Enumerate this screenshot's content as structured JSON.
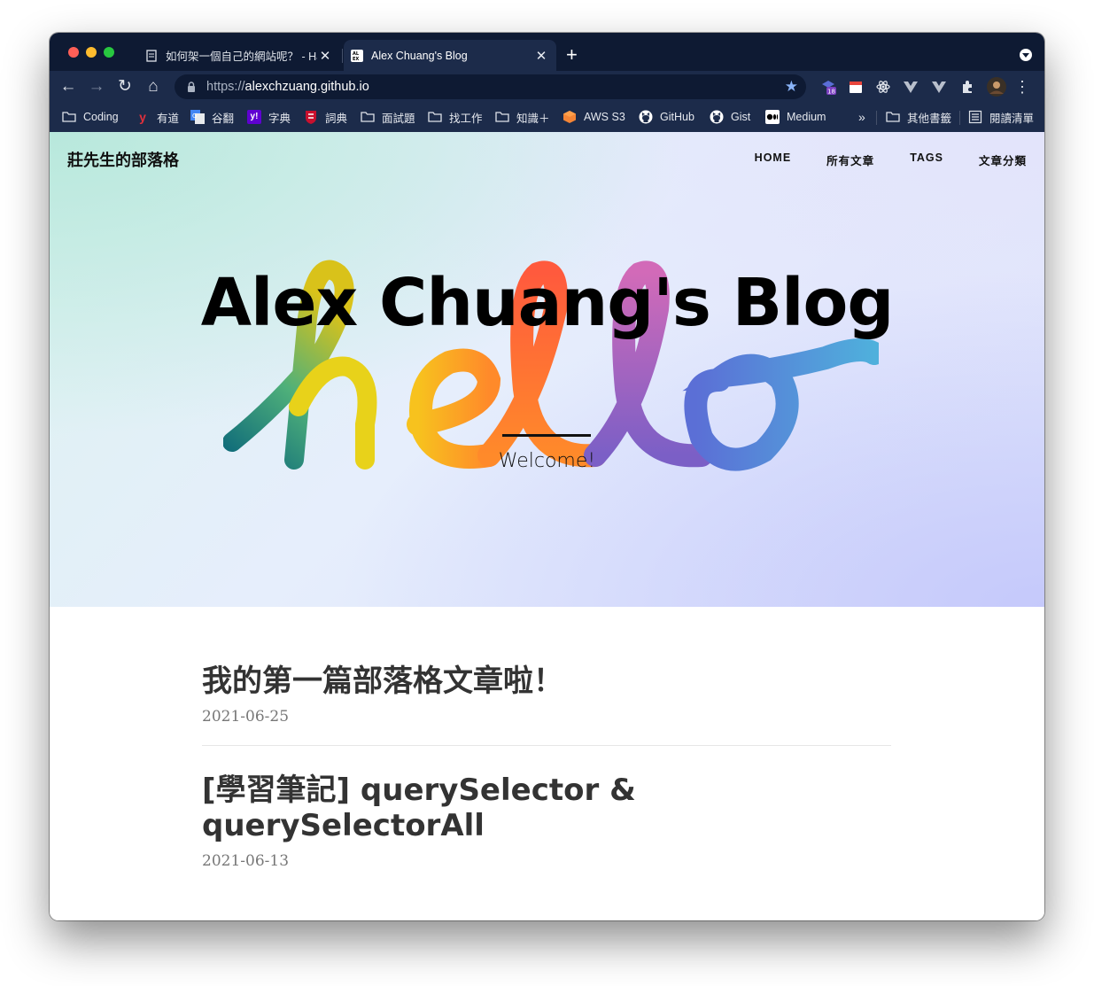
{
  "browser": {
    "tabs": [
      {
        "title": "如何架一個自己的網站呢？ - Ha",
        "active": false,
        "favicon": "document-icon"
      },
      {
        "title": "Alex Chuang's Blog",
        "active": true,
        "favicon": "site-favicon"
      }
    ],
    "url_scheme": "https://",
    "url_host": "alexchzuang.github.io",
    "extension_badge": "18",
    "bookmarks": [
      {
        "label": "Coding",
        "icon": "folder-icon"
      },
      {
        "label": "有道",
        "icon": "youdao-icon"
      },
      {
        "label": "谷翻",
        "icon": "google-translate-icon"
      },
      {
        "label": "字典",
        "icon": "yahoo-icon"
      },
      {
        "label": "詞典",
        "icon": "cambridge-icon"
      },
      {
        "label": "面試題",
        "icon": "folder-icon"
      },
      {
        "label": "找工作",
        "icon": "folder-icon"
      },
      {
        "label": "知識＋",
        "icon": "folder-icon"
      },
      {
        "label": "AWS S3",
        "icon": "aws-icon"
      },
      {
        "label": "GitHub",
        "icon": "github-icon"
      },
      {
        "label": "Gist",
        "icon": "github-icon"
      },
      {
        "label": "Medium",
        "icon": "medium-icon"
      }
    ],
    "overflow": "»",
    "other_bookmarks": "其他書籤",
    "reading_list": "閱讀清單"
  },
  "site": {
    "name": "莊先生的部落格",
    "nav": [
      "HOME",
      "所有文章",
      "TAGS",
      "文章分類"
    ],
    "hero_title": "Alex Chuang's Blog",
    "hero_subtitle": "Welcome!"
  },
  "posts": [
    {
      "title": "我的第一篇部落格文章啦！",
      "date": "2021-06-25"
    },
    {
      "title": "[學習筆記] querySelector & querySelectorAll",
      "date": "2021-06-13"
    }
  ],
  "colors": {
    "tabstrip": "#0e1a33",
    "toolbar": "#1c2b4a",
    "accent_star": "#8ab4f8"
  }
}
